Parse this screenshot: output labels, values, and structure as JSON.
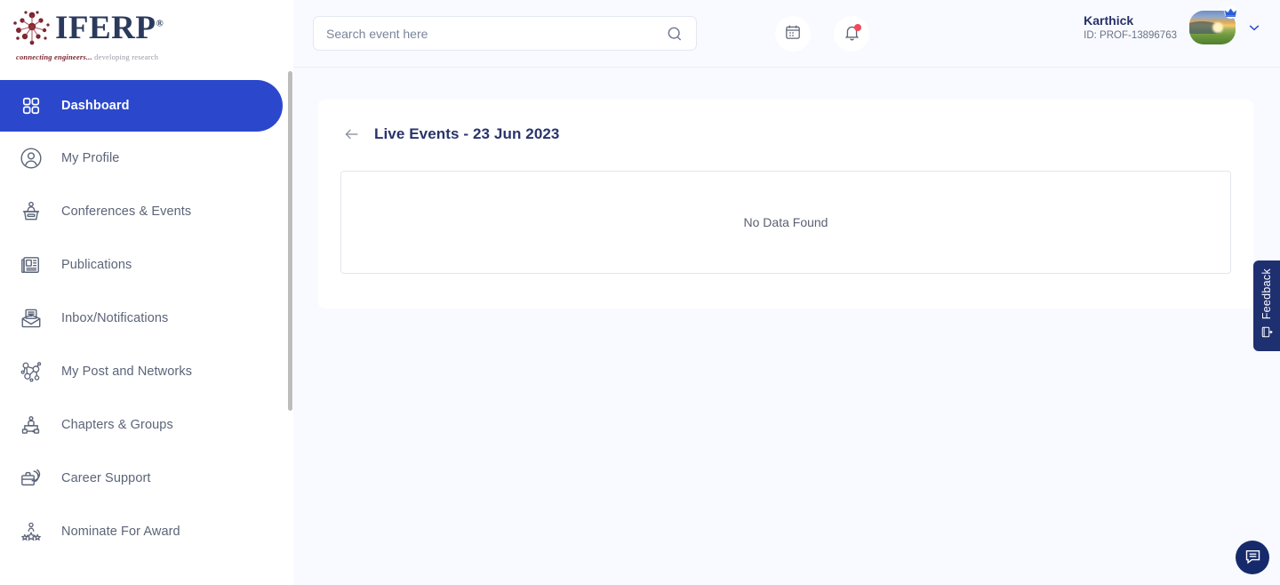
{
  "brand": {
    "name": "IFERP",
    "registered": "®",
    "tagline_1": "connecting engineers...",
    "tagline_2": "developing research",
    "logo_icon": "molecule-network-icon"
  },
  "sidebar": {
    "scrollbar": "sidebar-scrollbar",
    "items": [
      {
        "label": "Dashboard",
        "icon": "grid-icon",
        "active": true
      },
      {
        "label": "My Profile",
        "icon": "user-circle-icon",
        "active": false
      },
      {
        "label": "Conferences & Events",
        "icon": "podium-icon",
        "active": false
      },
      {
        "label": "Publications",
        "icon": "newspaper-icon",
        "active": false
      },
      {
        "label": "Inbox/Notifications",
        "icon": "open-envelope-icon",
        "active": false
      },
      {
        "label": "My Post and Networks",
        "icon": "network-nodes-icon",
        "active": false
      },
      {
        "label": "Chapters & Groups",
        "icon": "group-chart-icon",
        "active": false
      },
      {
        "label": "Career Support",
        "icon": "briefcase-icon",
        "active": false
      },
      {
        "label": "Nominate For Award",
        "icon": "award-star-icon",
        "active": false
      }
    ]
  },
  "header": {
    "search": {
      "placeholder": "Search event here",
      "value": "",
      "icon": "search-icon"
    },
    "calendar_icon": "calendar-icon",
    "notification_icon": "bell-icon",
    "notification_badge": true,
    "user": {
      "name": "Karthick",
      "id": "ID: PROF-13896763",
      "avatar": "profile-photo",
      "badge_icon": "crown-icon",
      "dropdown_icon": "chevron-down-icon"
    }
  },
  "main": {
    "back_icon": "arrow-left-icon",
    "title": "Live Events - 23 Jun 2023",
    "empty_state": "No Data Found"
  },
  "widgets": {
    "feedback": {
      "label": "Feedback",
      "icon": "feedback-page-icon"
    },
    "chat": {
      "icon": "chat-bubble-icon",
      "label": ""
    }
  },
  "colors": {
    "accent_blue": "#2b48cc",
    "navy": "#1f3070",
    "title_navy": "#29346b",
    "page_bg": "#f8faff",
    "notification_red": "#f14b5a"
  }
}
